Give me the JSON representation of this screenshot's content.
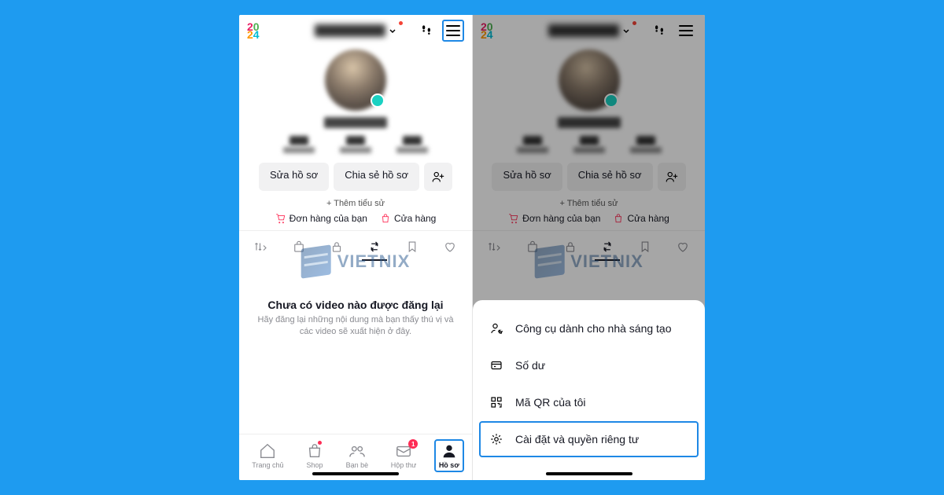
{
  "header": {
    "logo_line1a": "2",
    "logo_line1b": "0",
    "logo_line2a": "2",
    "logo_line2b": "4"
  },
  "buttons": {
    "edit_profile": "Sửa hồ sơ",
    "share_profile": "Chia sẻ hồ sơ",
    "add_bio": "+ Thêm tiểu sử"
  },
  "shop": {
    "orders": "Đơn hàng của bạn",
    "store": "Cửa hàng"
  },
  "watermark": "VIETNIX",
  "empty": {
    "title": "Chưa có video nào được đăng lại",
    "subtitle": "Hãy đăng lại những nội dung mà bạn thấy thú vị và các video sẽ xuất hiện ở đây."
  },
  "nav": {
    "home": "Trang chủ",
    "shop": "Shop",
    "friends": "Bạn bè",
    "inbox": "Hộp thư",
    "profile": "Hồ sơ",
    "inbox_badge": "1"
  },
  "sheet": {
    "creator_tools": "Công cụ dành cho nhà sáng tạo",
    "balance": "Số dư",
    "my_qr": "Mã QR của tôi",
    "settings_privacy": "Cài đặt và quyền riêng tư"
  }
}
